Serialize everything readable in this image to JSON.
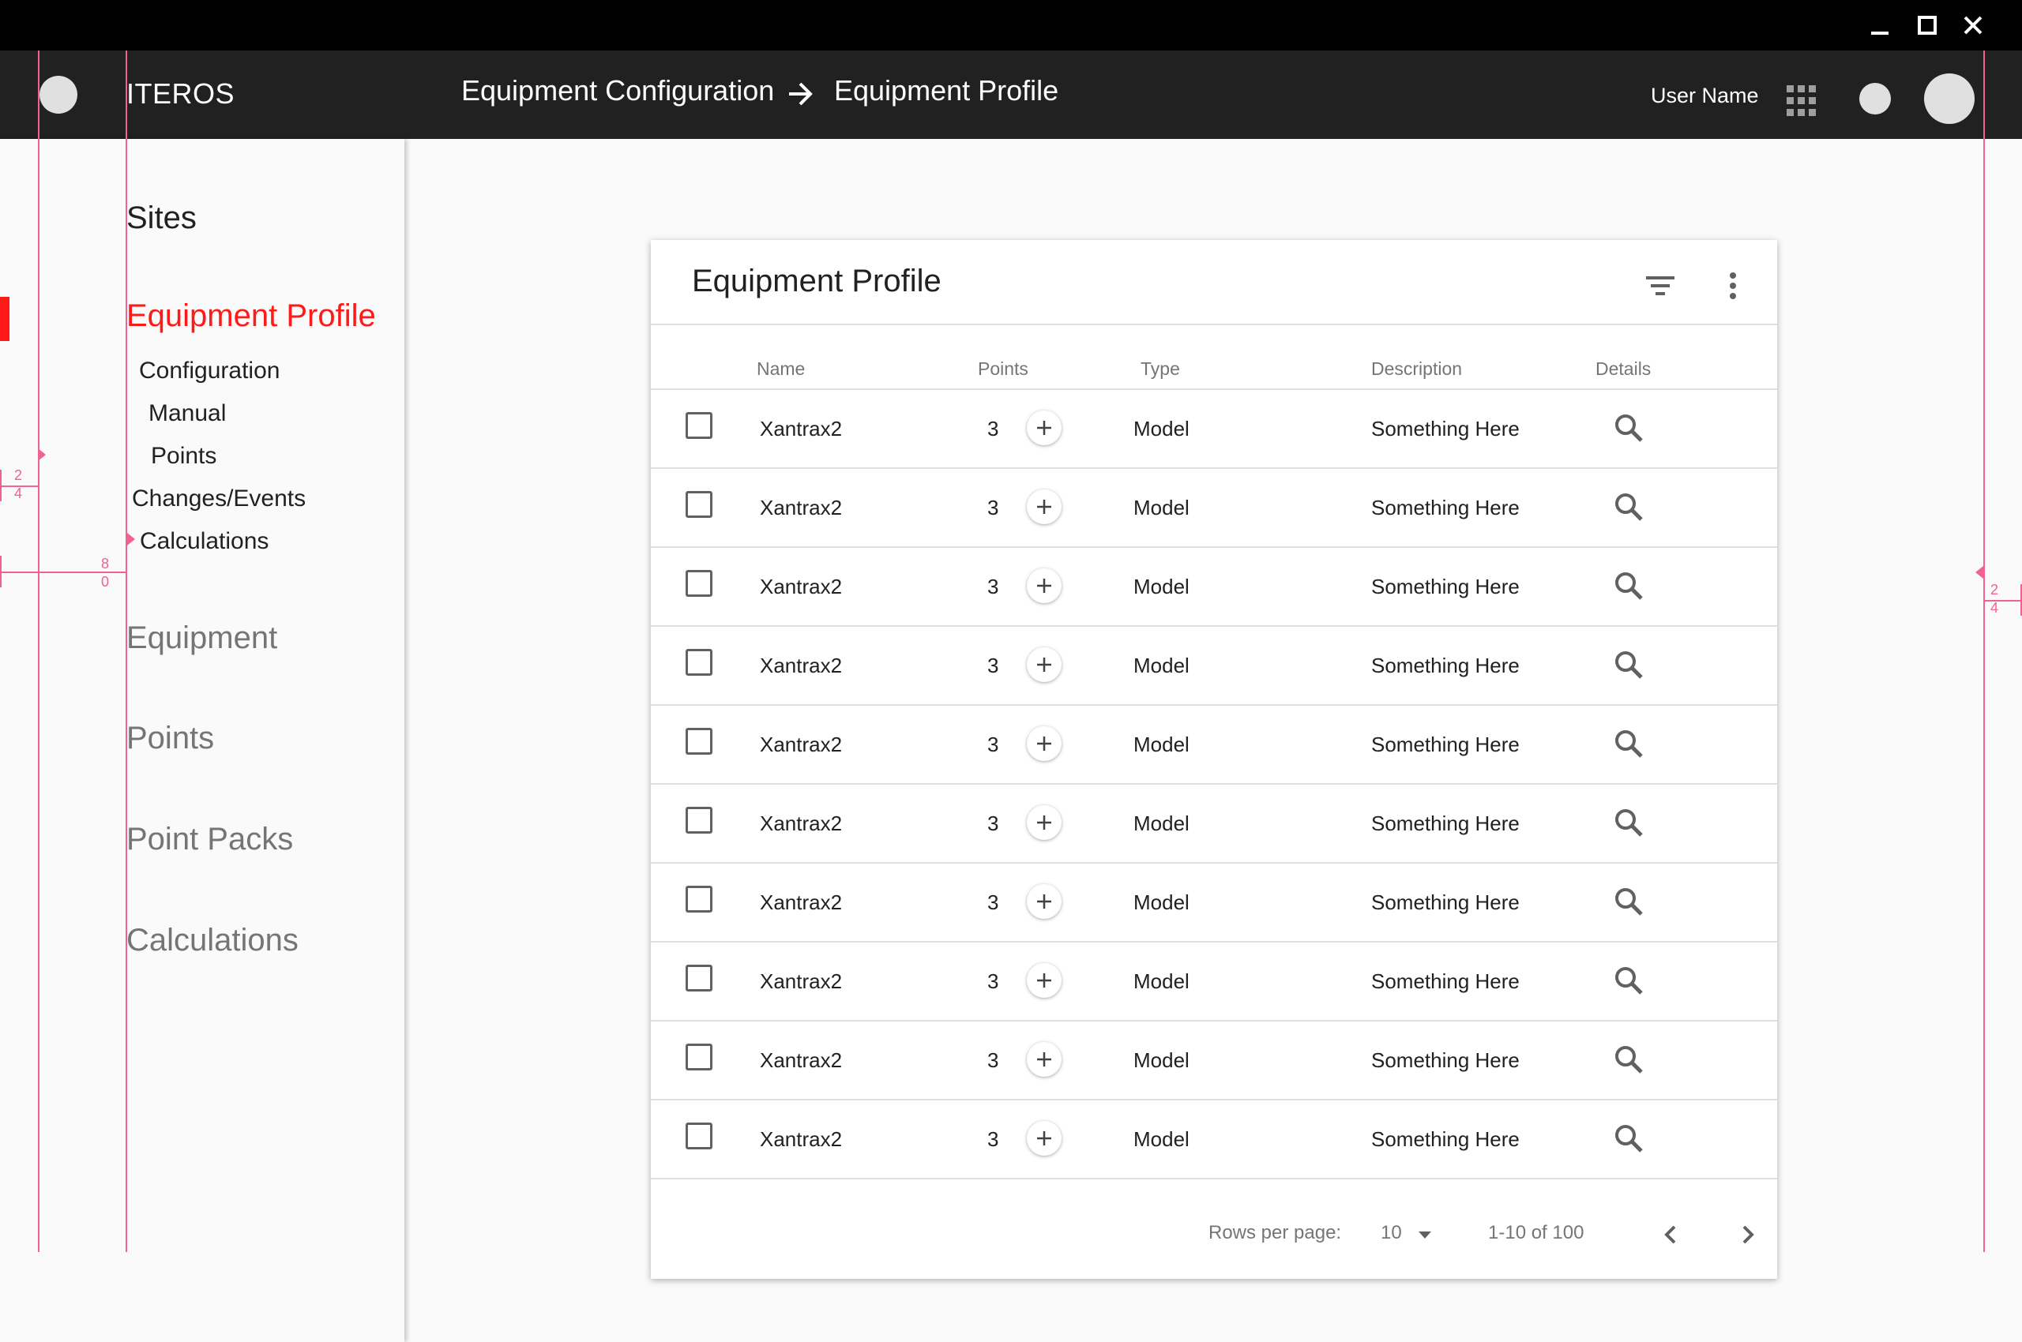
{
  "window": {
    "controls": [
      "minimize-icon",
      "maximize-icon",
      "close-icon"
    ]
  },
  "app": {
    "name": "ITEROS"
  },
  "breadcrumb": {
    "parent": "Equipment Configuration",
    "current": "Equipment Profile",
    "separator_icon": "arrow-right-icon"
  },
  "header": {
    "user_name": "User Name"
  },
  "sidebar": {
    "sites": "Sites",
    "equipment_profile": "Equipment Profile",
    "configuration": "Configuration",
    "manual": "Manual",
    "points": "Points",
    "changes_events": "Changes/Events",
    "calculations_sub": "Calculations",
    "equipment": "Equipment",
    "points_main": "Points",
    "point_packs": "Point Packs",
    "calculations": "Calculations"
  },
  "guides": {
    "left_a": "2",
    "left_b": "4",
    "left_c": "8",
    "left_d": "0",
    "right_a": "2",
    "right_b": "4"
  },
  "card": {
    "title": "Equipment Profile",
    "columns": {
      "name": "Name",
      "points": "Points",
      "type": "Type",
      "description": "Description",
      "details": "Details"
    },
    "rows": [
      {
        "name": "Xantrax2",
        "points": "3",
        "type": "Model",
        "description": "Something Here"
      },
      {
        "name": "Xantrax2",
        "points": "3",
        "type": "Model",
        "description": "Something Here"
      },
      {
        "name": "Xantrax2",
        "points": "3",
        "type": "Model",
        "description": "Something Here"
      },
      {
        "name": "Xantrax2",
        "points": "3",
        "type": "Model",
        "description": "Something Here"
      },
      {
        "name": "Xantrax2",
        "points": "3",
        "type": "Model",
        "description": "Something Here"
      },
      {
        "name": "Xantrax2",
        "points": "3",
        "type": "Model",
        "description": "Something Here"
      },
      {
        "name": "Xantrax2",
        "points": "3",
        "type": "Model",
        "description": "Something Here"
      },
      {
        "name": "Xantrax2",
        "points": "3",
        "type": "Model",
        "description": "Something Here"
      },
      {
        "name": "Xantrax2",
        "points": "3",
        "type": "Model",
        "description": "Something Here"
      },
      {
        "name": "Xantrax2",
        "points": "3",
        "type": "Model",
        "description": "Something Here"
      }
    ],
    "footer": {
      "rows_per_page_label": "Rows per page:",
      "rows_per_page_value": "10",
      "range": "1-10 of 100"
    }
  },
  "colors": {
    "accent": "#ff1a1a",
    "appbar": "#212121",
    "titlebar": "#000000",
    "guide": "#f06292"
  }
}
